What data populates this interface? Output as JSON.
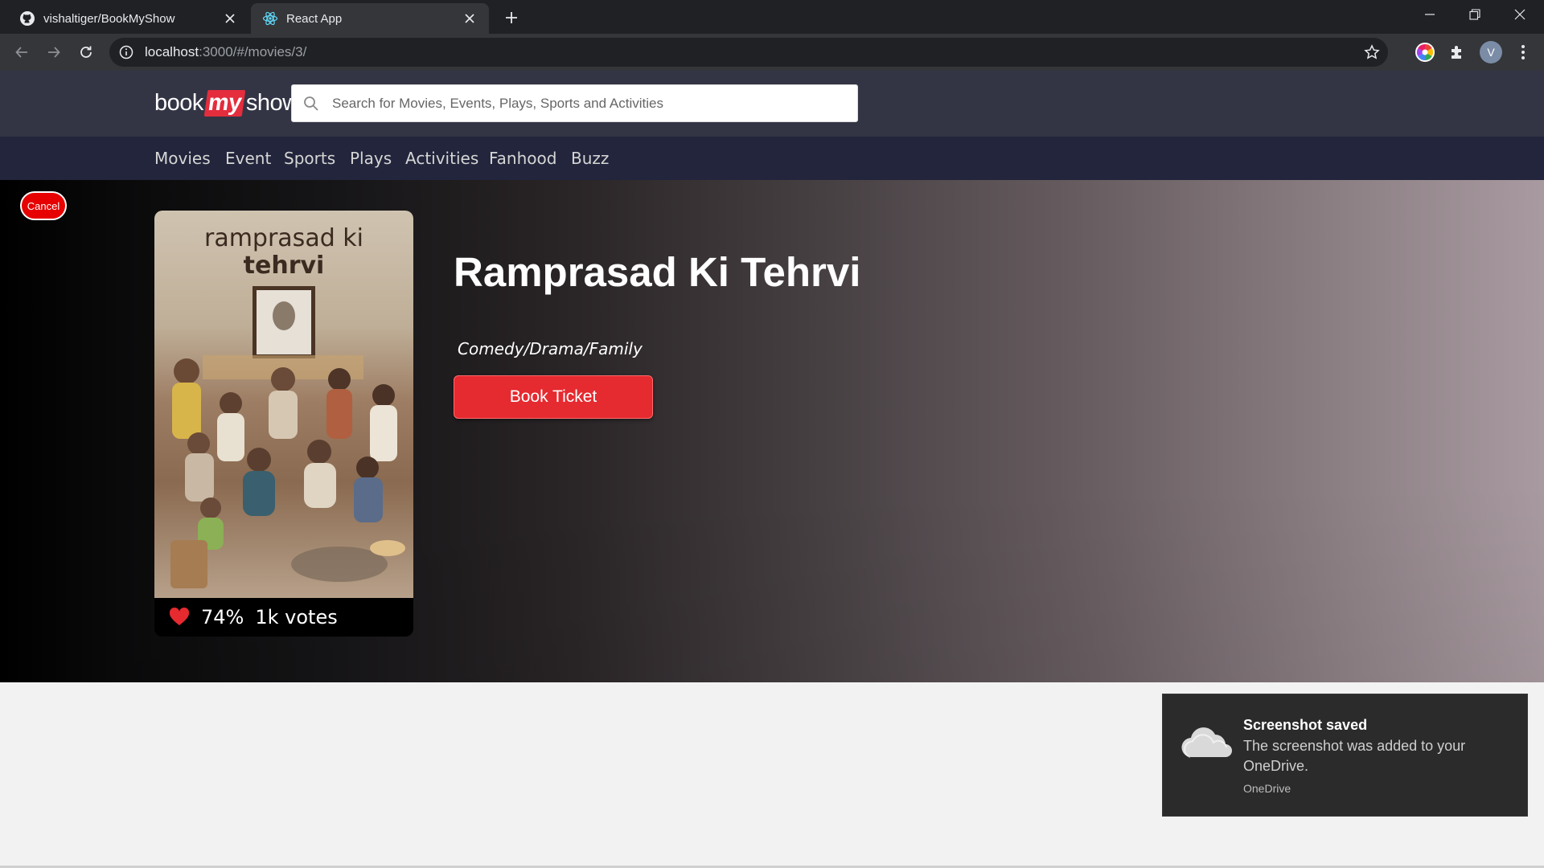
{
  "browser": {
    "tabs": [
      {
        "title": "vishaltiger/BookMyShow",
        "icon": "github-icon"
      },
      {
        "title": "React App",
        "icon": "react-icon"
      }
    ],
    "url_host": "localhost",
    "url_rest": ":3000/#/movies/3/",
    "profile_initial": "V"
  },
  "site": {
    "logo": {
      "part1": "book",
      "part2": "my",
      "part3": "show"
    },
    "search_placeholder": "Search for Movies, Events, Plays, Sports and Activities",
    "nav": [
      "Movies",
      "Event",
      "Sports",
      "Plays",
      "Activities",
      "Fanhood",
      "Buzz"
    ]
  },
  "movie": {
    "cancel_label": "Cancel",
    "poster_line1": "ramprasad ki",
    "poster_line2": "tehrvi",
    "rating_percent": "74%",
    "votes": "1k votes",
    "title": "Ramprasad Ki Tehrvi",
    "genre": "Comedy/Drama/Family",
    "book_label": "Book Ticket"
  },
  "toast": {
    "title": "Screenshot saved",
    "body": "The screenshot was added to your OneDrive.",
    "source": "OneDrive"
  },
  "colors": {
    "brand_red": "#e52a30",
    "header_bg": "#333545",
    "nav_bg": "#22253b"
  }
}
